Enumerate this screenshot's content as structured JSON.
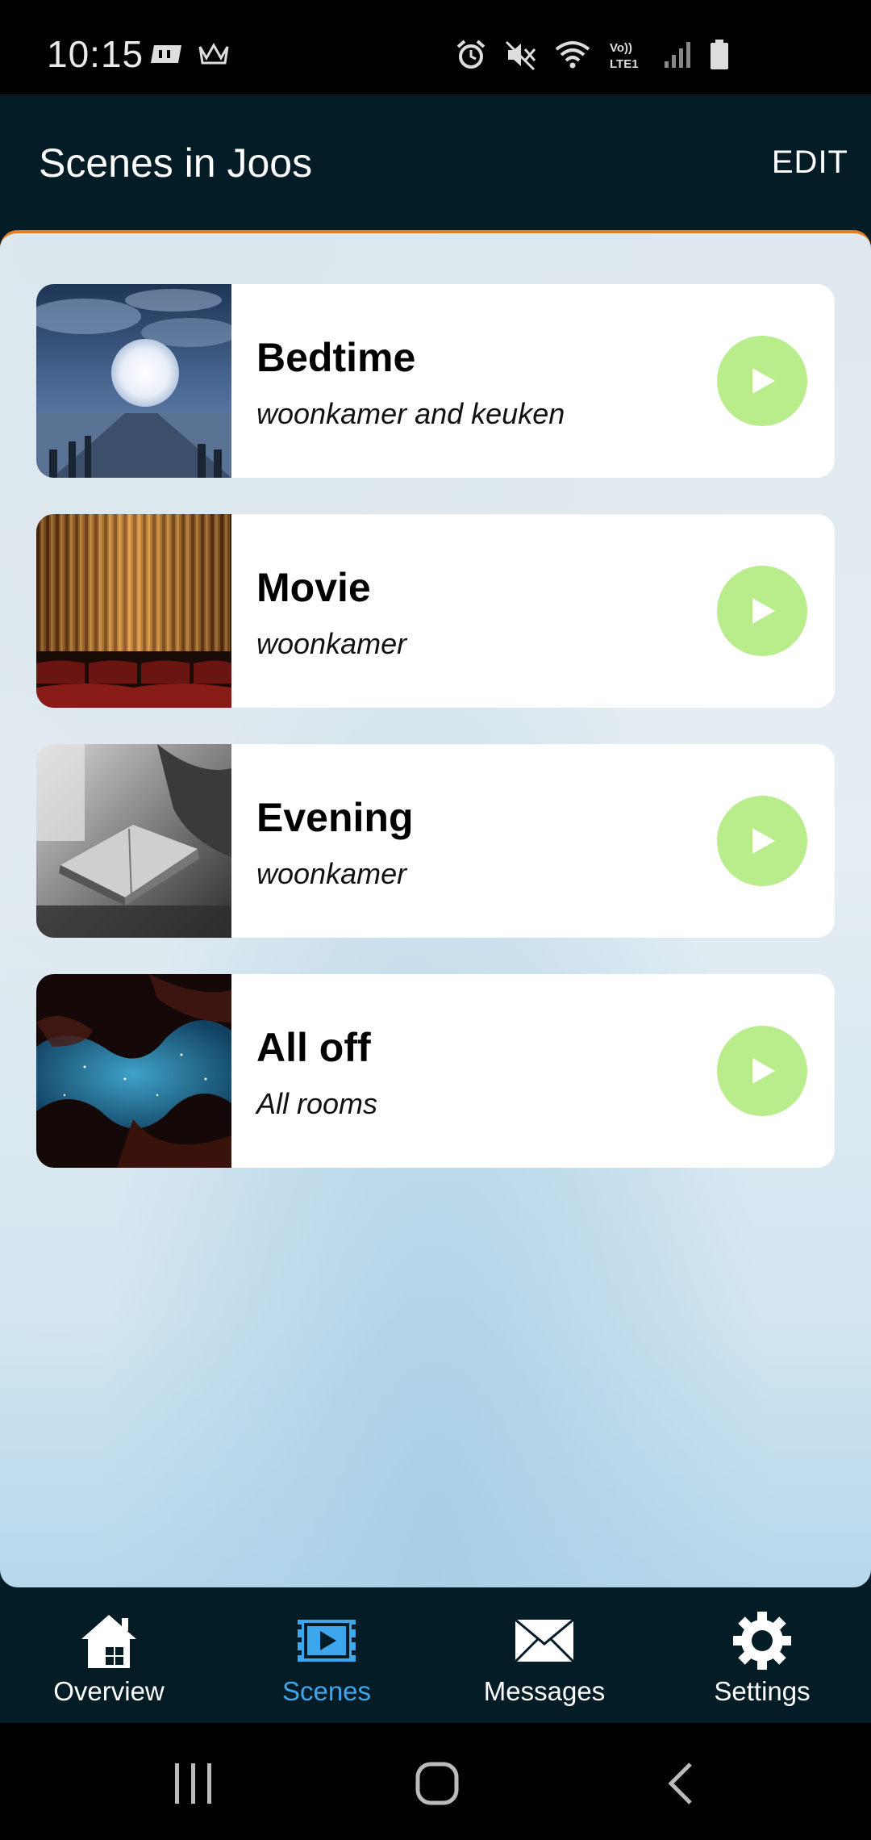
{
  "status_bar": {
    "time": "10:15",
    "left_icons": [
      "game-pad-icon",
      "crown-icon"
    ],
    "right_icons": [
      "alarm-icon",
      "mute-icon",
      "wifi-icon",
      "volte-icon",
      "signal-icon",
      "battery-icon"
    ],
    "volte_label": "Vo)) LTE1"
  },
  "app_bar": {
    "title": "Scenes in Joos",
    "edit_label": "EDIT"
  },
  "colors": {
    "app_bar_bg": "#041c25",
    "accent_orange": "#e07e22",
    "play_green": "#b9ec8a",
    "active_blue": "#3ea6ec"
  },
  "scenes": [
    {
      "name": "Bedtime",
      "rooms": "woonkamer and keuken",
      "thumbnail": "moon-pier-image"
    },
    {
      "name": "Movie",
      "rooms": "woonkamer",
      "thumbnail": "cinema-curtain-image"
    },
    {
      "name": "Evening",
      "rooms": "woonkamer",
      "thumbnail": "book-reading-image"
    },
    {
      "name": "All off",
      "rooms": "All rooms",
      "thumbnail": "night-sky-canyon-image"
    }
  ],
  "bottom_nav": {
    "items": [
      {
        "label": "Overview",
        "icon": "house-icon",
        "active": false
      },
      {
        "label": "Scenes",
        "icon": "scenes-icon",
        "active": true
      },
      {
        "label": "Messages",
        "icon": "envelope-icon",
        "active": false
      },
      {
        "label": "Settings",
        "icon": "gear-icon",
        "active": false
      }
    ]
  },
  "system_nav": {
    "buttons": [
      "recents-icon",
      "home-icon",
      "back-icon"
    ]
  }
}
